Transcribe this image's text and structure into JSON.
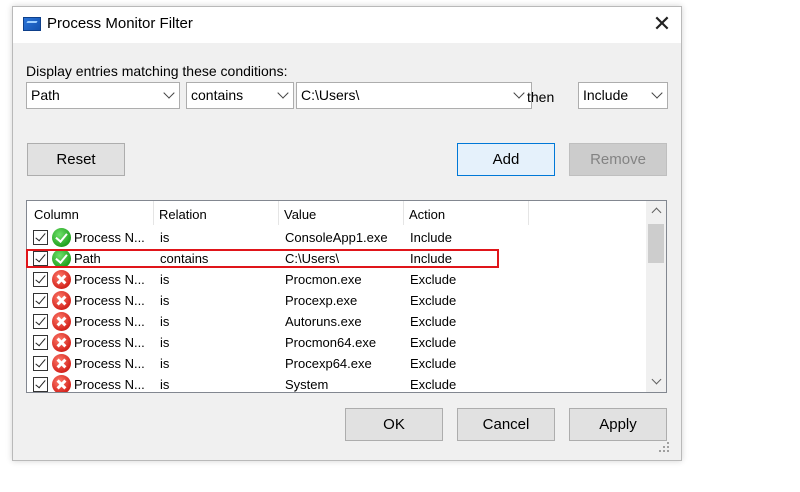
{
  "window": {
    "title": "Process Monitor Filter"
  },
  "caption": "Display entries matching these conditions:",
  "filter": {
    "column": "Path",
    "relation": "contains",
    "value": "C:\\Users\\",
    "then_label": "then",
    "action": "Include"
  },
  "buttons": {
    "reset": "Reset",
    "add": "Add",
    "remove": "Remove",
    "ok": "OK",
    "cancel": "Cancel",
    "apply": "Apply"
  },
  "list": {
    "headers": [
      "Column",
      "Relation",
      "Value",
      "Action"
    ],
    "rows": [
      {
        "checked": true,
        "status": "include",
        "column": "Process N...",
        "relation": "is",
        "value": "ConsoleApp1.exe",
        "action": "Include"
      },
      {
        "checked": true,
        "status": "include",
        "column": "Path",
        "relation": "contains",
        "value": "C:\\Users\\",
        "action": "Include"
      },
      {
        "checked": true,
        "status": "exclude",
        "column": "Process N...",
        "relation": "is",
        "value": "Procmon.exe",
        "action": "Exclude"
      },
      {
        "checked": true,
        "status": "exclude",
        "column": "Process N...",
        "relation": "is",
        "value": "Procexp.exe",
        "action": "Exclude"
      },
      {
        "checked": true,
        "status": "exclude",
        "column": "Process N...",
        "relation": "is",
        "value": "Autoruns.exe",
        "action": "Exclude"
      },
      {
        "checked": true,
        "status": "exclude",
        "column": "Process N...",
        "relation": "is",
        "value": "Procmon64.exe",
        "action": "Exclude"
      },
      {
        "checked": true,
        "status": "exclude",
        "column": "Process N...",
        "relation": "is",
        "value": "Procexp64.exe",
        "action": "Exclude"
      },
      {
        "checked": true,
        "status": "exclude",
        "column": "Process N...",
        "relation": "is",
        "value": "System",
        "action": "Exclude"
      }
    ]
  },
  "colors": {
    "highlight": "#e0151a",
    "primary_border": "#0078d7",
    "include": "#22a21f",
    "exclude": "#d4241d"
  }
}
